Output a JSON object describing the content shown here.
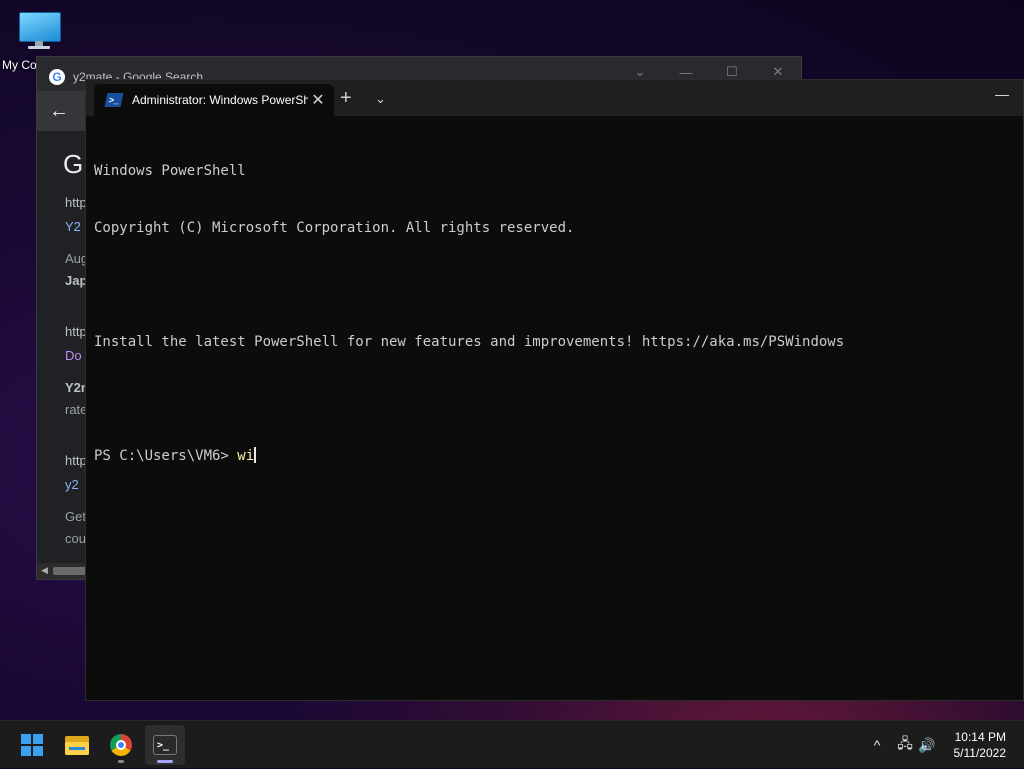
{
  "desktop": {
    "icon_label": "My Co"
  },
  "browser": {
    "tab_title": "y2mate - Google Search",
    "minimize": "—",
    "maximize": "☐",
    "close": "✕",
    "dropdown": "⌄",
    "back": "←",
    "logo_letter": "G",
    "results": [
      {
        "url": "http",
        "title": "Y2",
        "meta": "Aug",
        "snippet": "Jap"
      },
      {
        "url": "http",
        "title": "Do",
        "meta": "Y2n",
        "snippet": "rate"
      },
      {
        "url": "http",
        "title": "y2",
        "meta": "Get",
        "snippet": "cou"
      }
    ]
  },
  "terminal": {
    "tab_title": "Administrator: Windows PowerShell",
    "tab_close": "✕",
    "new_tab": "+",
    "dropdown": "⌄",
    "minimize": "—",
    "lines": [
      "Windows PowerShell",
      "Copyright (C) Microsoft Corporation. All rights reserved.",
      "",
      "Install the latest PowerShell for new features and improvements! https://aka.ms/PSWindows",
      ""
    ],
    "prompt": "PS C:\\Users\\VM6> ",
    "typed": "wi"
  },
  "taskbar": {
    "items": [
      "start-icon",
      "file-explorer-icon",
      "chrome-icon",
      "terminal-icon"
    ],
    "tray": {
      "chevron": "^",
      "network": "🖧",
      "volume": "🔊"
    },
    "clock_time": "10:14 PM",
    "clock_date": "5/11/2022"
  },
  "colors": {
    "accent": "#3aa0f0",
    "terminal_bg": "#0c0c0c",
    "terminal_text": "#cccccc",
    "typed_text": "#f9f1a5"
  }
}
